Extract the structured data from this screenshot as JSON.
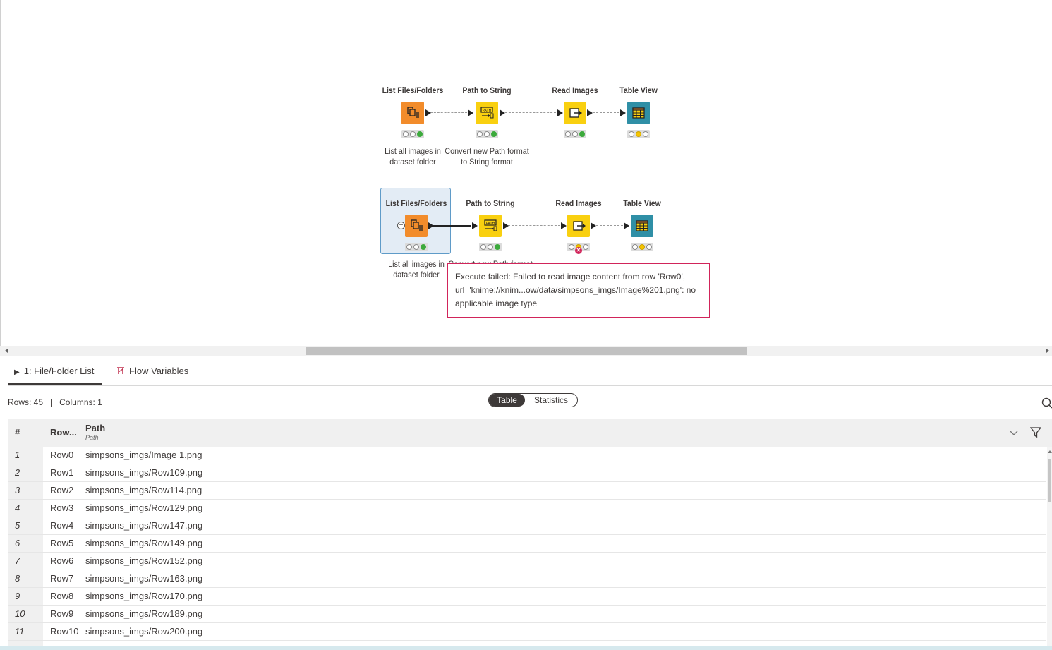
{
  "workflow": {
    "row1": {
      "nodes": [
        {
          "title": "List Files/Folders",
          "description_lines": [
            "List all images in",
            "dataset folder"
          ]
        },
        {
          "title": "Path to String",
          "description_lines": [
            "Convert new Path format",
            "to String format"
          ]
        },
        {
          "title": "Read Images",
          "description_lines": []
        },
        {
          "title": "Table View",
          "description_lines": []
        }
      ]
    },
    "row2": {
      "nodes": [
        {
          "title": "List Files/Folders",
          "description_lines": [
            "List all images in",
            "dataset folder"
          ]
        },
        {
          "title": "Path to String",
          "description_lines": [
            "Convert new Path format"
          ]
        },
        {
          "title": "Read Images",
          "description_lines": []
        },
        {
          "title": "Table View",
          "description_lines": []
        }
      ]
    },
    "error_tooltip": {
      "lines": [
        "Execute failed: Failed to read image content from row 'Row0',",
        "url='knime://knim...ow/data/simpsons_imgs/Image%201.png': no",
        "applicable image type"
      ]
    }
  },
  "panel": {
    "tabs": [
      {
        "label": "1: File/Folder List",
        "icon": "play-icon"
      },
      {
        "label": "Flow Variables",
        "icon": "flow-variable-icon"
      }
    ],
    "stats_text": "Rows: 45   |   Columns: 1",
    "view_toggle": {
      "table": "Table",
      "statistics": "Statistics"
    },
    "table": {
      "headers": {
        "index": "#",
        "rowid": "Row...",
        "path": "Path",
        "path_type": "Path"
      },
      "rows": [
        {
          "index": "1",
          "rowid": "Row0",
          "path": "simpsons_imgs/Image 1.png"
        },
        {
          "index": "2",
          "rowid": "Row1",
          "path": "simpsons_imgs/Row109.png"
        },
        {
          "index": "3",
          "rowid": "Row2",
          "path": "simpsons_imgs/Row114.png"
        },
        {
          "index": "4",
          "rowid": "Row3",
          "path": "simpsons_imgs/Row129.png"
        },
        {
          "index": "5",
          "rowid": "Row4",
          "path": "simpsons_imgs/Row147.png"
        },
        {
          "index": "6",
          "rowid": "Row5",
          "path": "simpsons_imgs/Row149.png"
        },
        {
          "index": "7",
          "rowid": "Row6",
          "path": "simpsons_imgs/Row152.png"
        },
        {
          "index": "8",
          "rowid": "Row7",
          "path": "simpsons_imgs/Row163.png"
        },
        {
          "index": "9",
          "rowid": "Row8",
          "path": "simpsons_imgs/Row170.png"
        },
        {
          "index": "10",
          "rowid": "Row9",
          "path": "simpsons_imgs/Row189.png"
        },
        {
          "index": "11",
          "rowid": "Row10",
          "path": "simpsons_imgs/Row200.png"
        }
      ]
    }
  },
  "colors": {
    "accent_orange": "#f28c2b",
    "accent_yellow": "#f9d010",
    "accent_teal": "#2f8fa6",
    "error": "#d1245a"
  }
}
